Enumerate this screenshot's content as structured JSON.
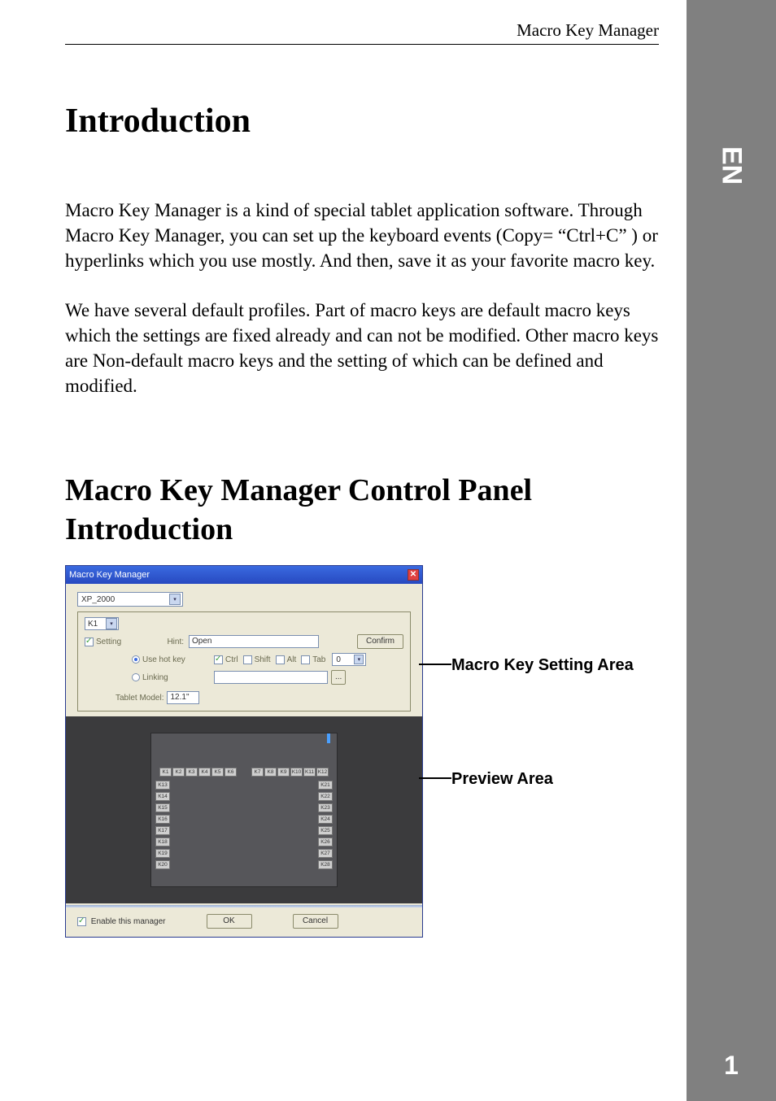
{
  "header": {
    "doc_title": "Macro Key Manager"
  },
  "sidebar": {
    "lang": "EN",
    "page_number": "1"
  },
  "headings": {
    "intro": "Introduction",
    "section2": "Macro Key Manager Control Panel Introduction"
  },
  "paragraphs": {
    "p1": "Macro Key Manager is a kind of special tablet application software. Through Macro Key Manager, you can set up the keyboard events (Copy= “Ctrl+C” ) or hyperlinks which you use mostly. And then, save it as your favorite macro key.",
    "p2": "We have several default profiles. Part of macro keys are default macro keys which the settings are fixed already and can not be modified. Other macro keys are Non-default macro keys and the setting of which can be defined and modified."
  },
  "callouts": {
    "setting_area": "Macro Key Setting Area",
    "preview_area": "Preview Area"
  },
  "panel": {
    "window_title": "Macro Key Manager",
    "profile": "XP_2000",
    "key_select": "K1",
    "setting_checkbox": "Setting",
    "hint_label": "Hint:",
    "hint_value": "Open",
    "confirm_btn": "Confirm",
    "hotkey_radio": "Use hot key",
    "mod_ctrl": "Ctrl",
    "mod_shift": "Shift",
    "mod_alt": "Alt",
    "mod_tab": "Tab",
    "hotkey_value": "0",
    "linking_radio": "Linking",
    "browse_btn": "...",
    "tablet_model_label": "Tablet Model:",
    "tablet_model_value": "12.1\"",
    "enable_label": "Enable this manager",
    "ok_btn": "OK",
    "cancel_btn": "Cancel",
    "keys_top_left": [
      "K1",
      "K2",
      "K3",
      "K4",
      "K5",
      "K6"
    ],
    "keys_top_right": [
      "K7",
      "K8",
      "K9",
      "K10",
      "K11",
      "K12"
    ],
    "keys_left": [
      "K13",
      "K14",
      "K15",
      "K16",
      "K17",
      "K18",
      "K19",
      "K20"
    ],
    "keys_right": [
      "K21",
      "K22",
      "K23",
      "K24",
      "K25",
      "K26",
      "K27",
      "K28"
    ]
  }
}
